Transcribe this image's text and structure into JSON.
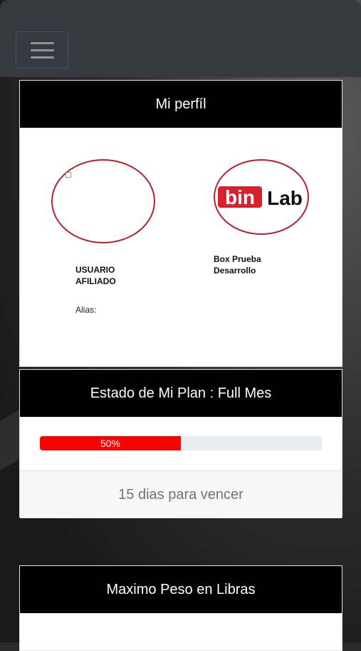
{
  "navbar": {
    "menu_icon": "hamburger-icon"
  },
  "profile": {
    "title": "Mi perfíl",
    "user_name_line1": "USUARIO",
    "user_name_line2": "AFILIADO",
    "alias_label": "Alias:",
    "box_line1": "Box Prueba",
    "box_line2": "Desarrollo",
    "logo_text_1": "bin",
    "logo_text_2": "Lab",
    "accent_color": "#b7232c"
  },
  "plan": {
    "title": "Estado de Mi Plan : Full Mes",
    "progress_label": "50%",
    "progress_value": 0.5,
    "progress_color": "#ff0000",
    "days_left": "15 dias para vencer"
  },
  "max_weight": {
    "title": "Maximo Peso en Libras"
  }
}
